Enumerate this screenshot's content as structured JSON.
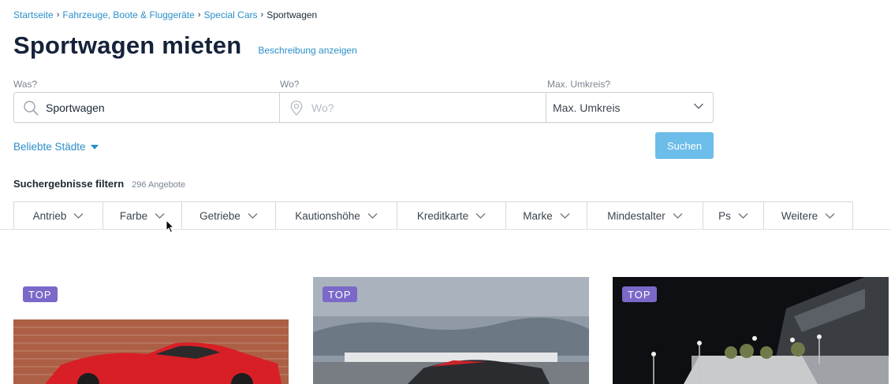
{
  "breadcrumb": {
    "items": [
      "Startseite",
      "Fahrzeuge, Boote & Fluggeräte",
      "Special Cars"
    ],
    "current": "Sportwagen"
  },
  "page": {
    "title": "Sportwagen mieten",
    "description_link": "Beschreibung anzeigen"
  },
  "search": {
    "what_label": "Was?",
    "what_value": "Sportwagen",
    "where_label": "Wo?",
    "where_placeholder": "Wo?",
    "radius_label": "Max. Umkreis?",
    "radius_value": "Max. Umkreis",
    "popular_cities": "Beliebte Städte",
    "submit_label": "Suchen"
  },
  "filters": {
    "title": "Suchergebnisse filtern",
    "count": "296 Angebote",
    "items": [
      "Antrieb",
      "Farbe",
      "Getriebe",
      "Kautionshöhe",
      "Kreditkarte",
      "Marke",
      "Mindestalter",
      "Ps",
      "Weitere"
    ]
  },
  "listings": [
    {
      "badge": "TOP"
    },
    {
      "badge": "TOP"
    },
    {
      "badge": "TOP"
    }
  ],
  "colors": {
    "link": "#2a8fc8",
    "button": "#6cbde9",
    "badge": "#7b68c9",
    "title": "#15223a"
  }
}
